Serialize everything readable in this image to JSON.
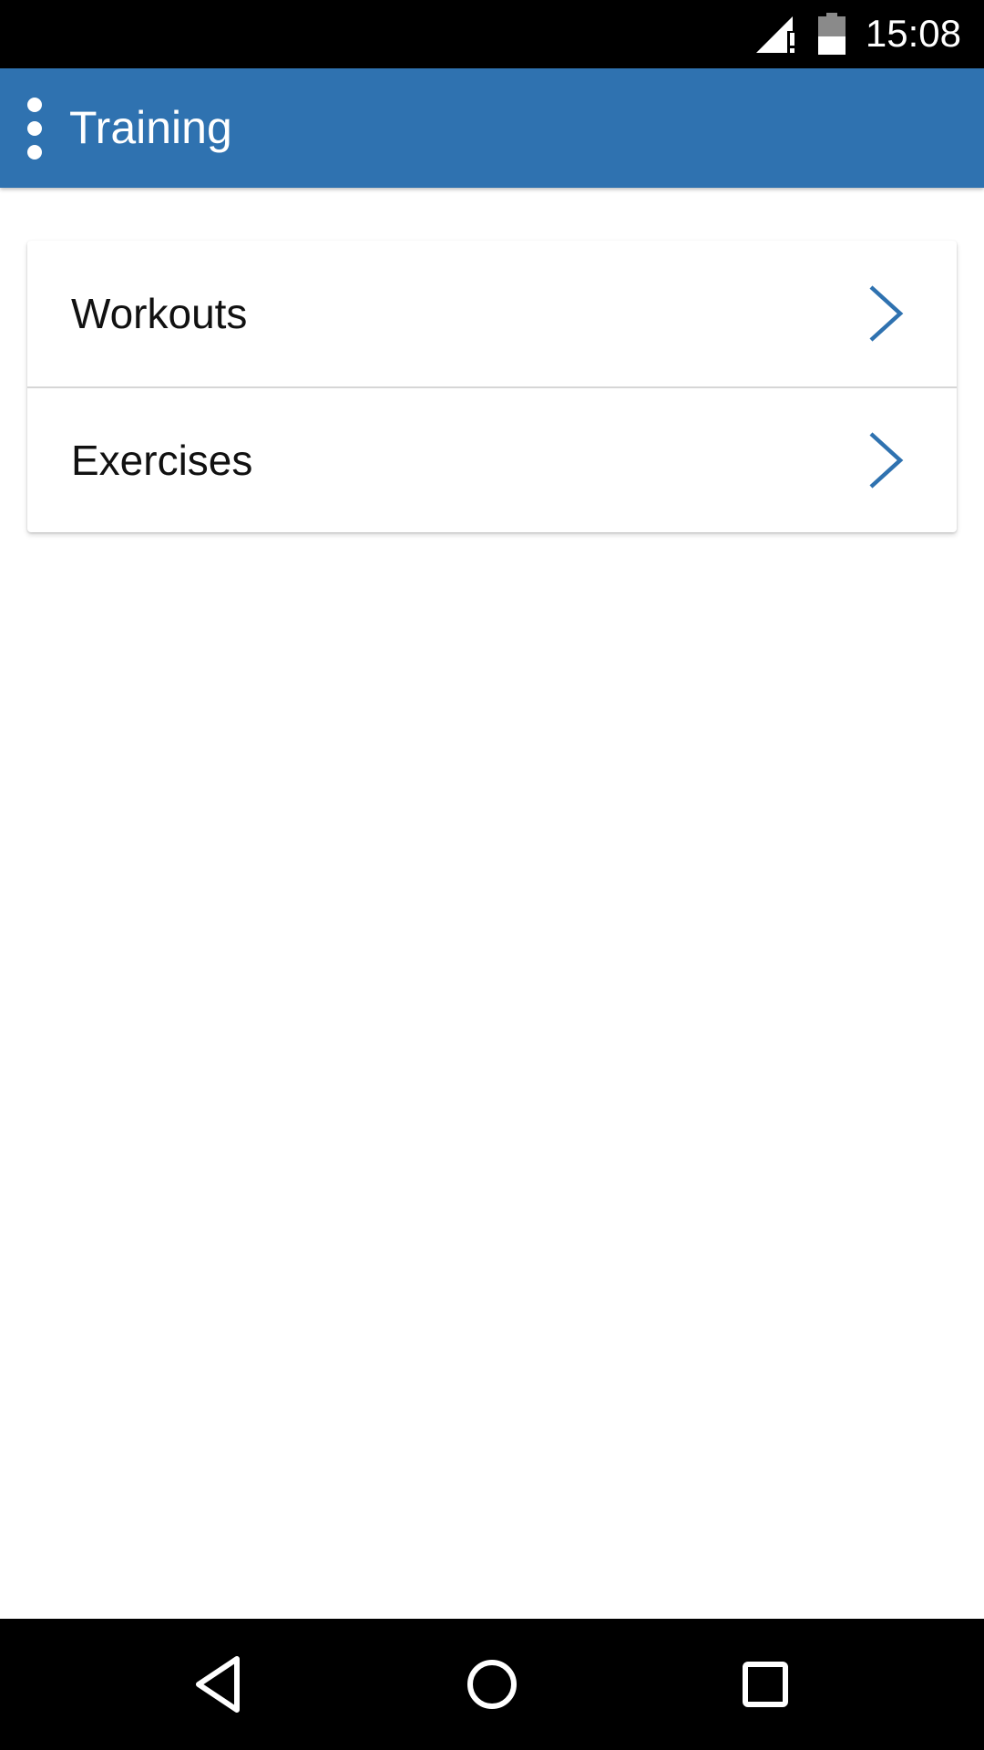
{
  "status_bar": {
    "time": "15:08",
    "signal_icon": "signal-alert-icon",
    "battery_icon": "battery-half-icon"
  },
  "app_bar": {
    "title": "Training",
    "menu_icon": "vertical-dots-icon",
    "background_color": "#2f72b0"
  },
  "menu_list": {
    "items": [
      {
        "label": "Workouts",
        "icon": "chevron-right-icon"
      },
      {
        "label": "Exercises",
        "icon": "chevron-right-icon"
      }
    ],
    "accent_color": "#2f72b0"
  },
  "nav_bar": {
    "buttons": [
      {
        "icon": "back-triangle-icon"
      },
      {
        "icon": "home-circle-icon"
      },
      {
        "icon": "recents-square-icon"
      }
    ]
  }
}
